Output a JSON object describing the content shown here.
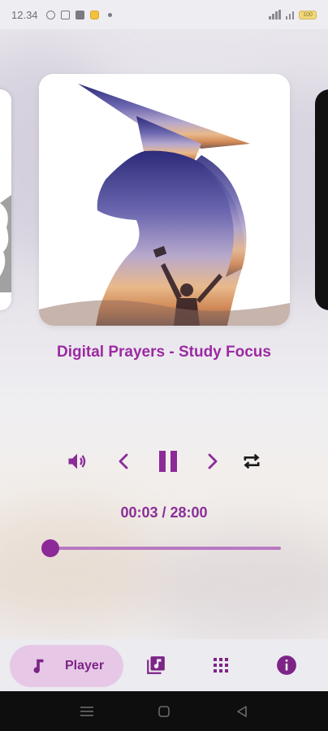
{
  "status_bar": {
    "time": "12.34",
    "battery": "100"
  },
  "player": {
    "track_title": "Digital Prayers - Study Focus",
    "time_display": "00:03 / 28:00",
    "progress": 0.0018
  },
  "bottom_nav": {
    "items": [
      {
        "label": "Player",
        "icon": "music-note-icon",
        "active": true
      },
      {
        "label": "",
        "icon": "playlist-icon"
      },
      {
        "label": "",
        "icon": "grid-apps-icon"
      },
      {
        "label": "",
        "icon": "info-icon"
      }
    ]
  },
  "colors": {
    "accent": "#9b2aa2",
    "accent_dark": "#8c2a98",
    "pill": "#e6c8e6"
  }
}
